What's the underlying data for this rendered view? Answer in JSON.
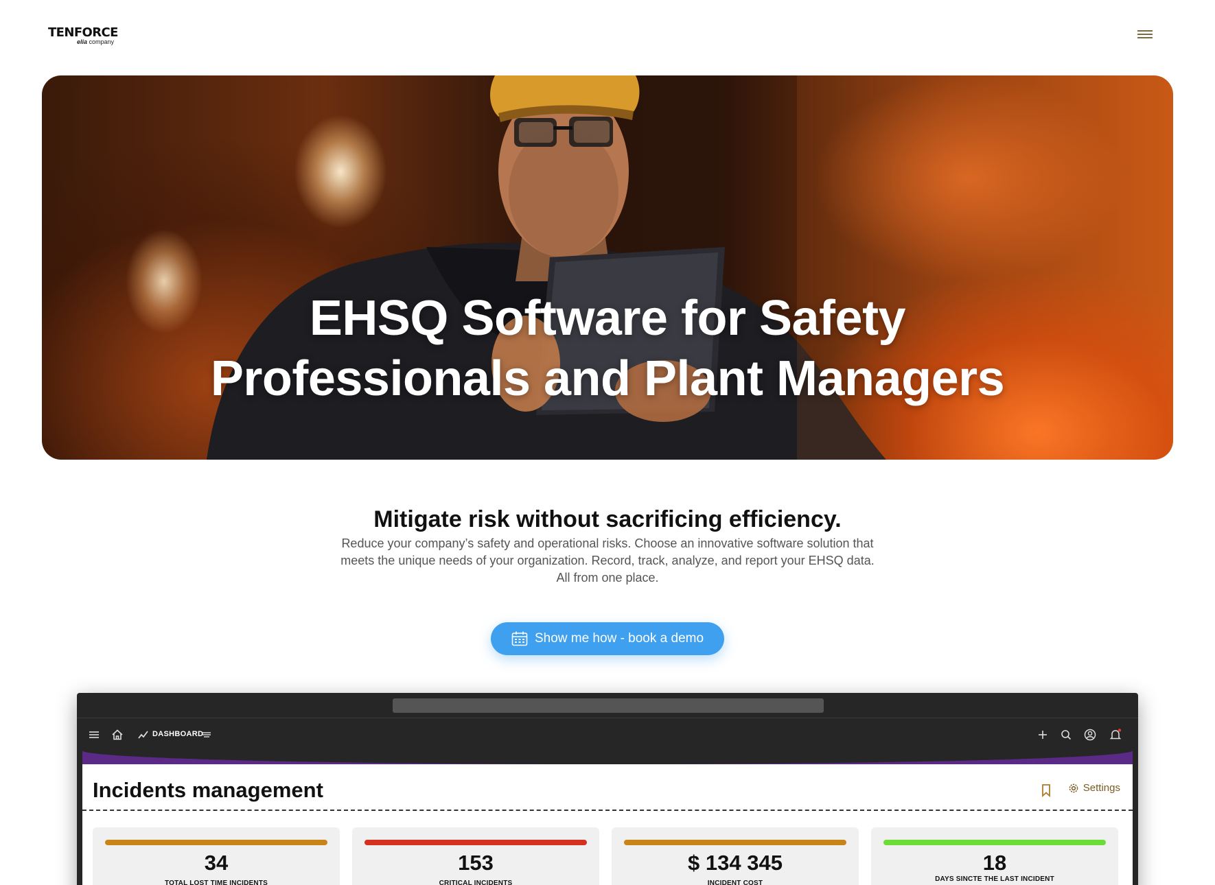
{
  "header": {
    "logo_main": "TENFORCE",
    "logo_sub_brand": "elia",
    "logo_sub_suffix": "company",
    "menu_icon": "hamburger-icon"
  },
  "hero": {
    "title_line1": "EHSQ Software for Safety",
    "title_line2": "Professionals and Plant Managers"
  },
  "intro": {
    "title": "Mitigate risk without sacrificing efficiency.",
    "text": "Reduce your company’s safety and operational risks. Choose an innovative software solution that meets the unique needs of your organization. Record, track, analyze, and report your EHSQ data. All from one place."
  },
  "cta": {
    "label": "Show me how - book a demo",
    "icon": "calendar-icon",
    "color": "#3fa0f0"
  },
  "app": {
    "nav_label": "DASHBOARD",
    "page_title": "Incidents management",
    "settings_label": "Settings",
    "accent": "#5b2a86",
    "kpis": [
      {
        "value": "34",
        "label": "TOTAL LOST TIME INCIDENTS",
        "color": "#c98418"
      },
      {
        "value": "153",
        "label": "CRITICAL INCIDENTS",
        "color": "#d6311f"
      },
      {
        "value": "$ 134 345",
        "label": "INCIDENT COST",
        "color": "#c98418"
      },
      {
        "value": "18",
        "label": "DAYS SINCTE THE LAST INCIDENT",
        "color": "#6cdc36"
      }
    ]
  }
}
